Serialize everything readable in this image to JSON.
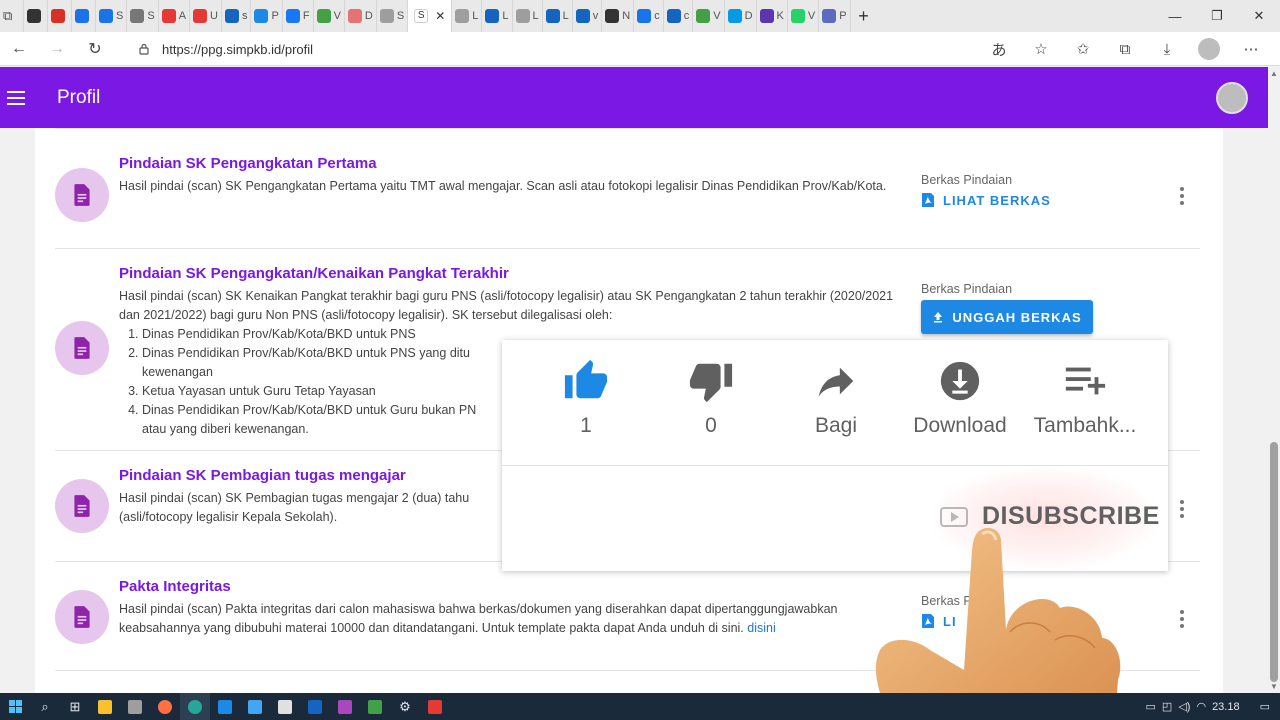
{
  "browser": {
    "tabs": [
      {
        "letter": "",
        "color": "#333333"
      },
      {
        "letter": "",
        "color": "#d93025"
      },
      {
        "letter": "",
        "color": "#1a73e8"
      },
      {
        "letter": "S",
        "color": "#1a73e8"
      },
      {
        "letter": "S",
        "color": "#777777"
      },
      {
        "letter": "A",
        "color": "#e53935"
      },
      {
        "letter": "U",
        "color": "#e53935"
      },
      {
        "letter": "s",
        "color": "#1565c0"
      },
      {
        "letter": "P",
        "color": "#1e88e5"
      },
      {
        "letter": "F",
        "color": "#1877f2"
      },
      {
        "letter": "V",
        "color": "#43a047"
      },
      {
        "letter": "D",
        "color": "#e57373"
      },
      {
        "letter": "S",
        "color": "#9e9e9e"
      }
    ],
    "active_tab": {
      "letter": "S",
      "close": "✕"
    },
    "tabs_right": [
      {
        "letter": "L",
        "color": "#9e9e9e"
      },
      {
        "letter": "L",
        "color": "#1565c0"
      },
      {
        "letter": "L",
        "color": "#9e9e9e"
      },
      {
        "letter": "L",
        "color": "#1565c0"
      },
      {
        "letter": "v",
        "color": "#1565c0"
      },
      {
        "letter": "N",
        "color": "#333333"
      },
      {
        "letter": "c",
        "color": "#1a73e8"
      },
      {
        "letter": "c",
        "color": "#1565c0"
      },
      {
        "letter": "V",
        "color": "#43a047"
      },
      {
        "letter": "D",
        "color": "#039be5"
      },
      {
        "letter": "K",
        "color": "#5e35b1"
      },
      {
        "letter": "V",
        "color": "#25d366"
      },
      {
        "letter": "P",
        "color": "#5c6bc0"
      }
    ],
    "new_tab": "+",
    "url": "https://ppg.simpkb.id/profil"
  },
  "app": {
    "title": "Profil"
  },
  "rows": [
    {
      "title": "Pindaian SK Pengangkatan Pertama",
      "desc": "Hasil pindai (scan) SK Pengangkatan Pertama yaitu TMT awal mengajar. Scan asli atau fotokopi legalisir Dinas Pendidikan Prov/Kab/Kota.",
      "berkas_label": "Berkas Pindaian",
      "action": "LIHAT BERKAS"
    },
    {
      "title": "Pindaian SK Pengangkatan/Kenaikan Pangkat Terakhir",
      "desc": "Hasil pindai (scan) SK Kenaikan Pangkat terakhir bagi guru PNS (asli/fotocopy legalisir) atau SK Pengangkatan 2 tahun terakhir (2020/2021 dan 2021/2022) bagi guru Non PNS (asli/fotocopy legalisir). SK tersebut dilegalisasi oleh:",
      "list": [
        "Dinas Pendidikan Prov/Kab/Kota/BKD untuk PNS",
        "Dinas Pendidikan Prov/Kab/Kota/BKD untuk PNS yang ditu kewenangan",
        "Ketua Yayasan untuk Guru Tetap Yayasan",
        "Dinas Pendidikan Prov/Kab/Kota/BKD untuk Guru bukan PN atau yang diberi kewenangan."
      ],
      "berkas_label": "Berkas Pindaian",
      "action": "UNGGAH BERKAS"
    },
    {
      "title": "Pindaian SK Pembagian tugas mengajar",
      "desc": "Hasil pindai (scan) SK Pembagian tugas mengajar 2 (dua) tahu (asli/fotocopy legalisir Kepala Sekolah)."
    },
    {
      "title": "Pakta Integritas",
      "desc": "Hasil pindai (scan) Pakta integritas dari calon mahasiswa bahwa berkas/dokumen yang diserahkan dapat dipertanggungjawabkan keabsahannya yang dibubuhi materai 10000 dan ditandatangani. Untuk template pakta dapat Anda unduh di sini.",
      "link": "disini",
      "berkas_label": "Berkas Pi",
      "action": "LI"
    }
  ],
  "yt": {
    "like_count": "1",
    "dislike_count": "0",
    "share": "Bagi",
    "download": "Download",
    "add": "Tambahk...",
    "subscribe": "DISUBSCRIBE"
  },
  "taskbar": {
    "time": "23.18"
  },
  "icons": {
    "lock": "🔒",
    "back": "←",
    "forward": "→",
    "reload": "↻",
    "pdf": "pdf-icon",
    "document": "document-icon",
    "upload": "upload-icon"
  }
}
